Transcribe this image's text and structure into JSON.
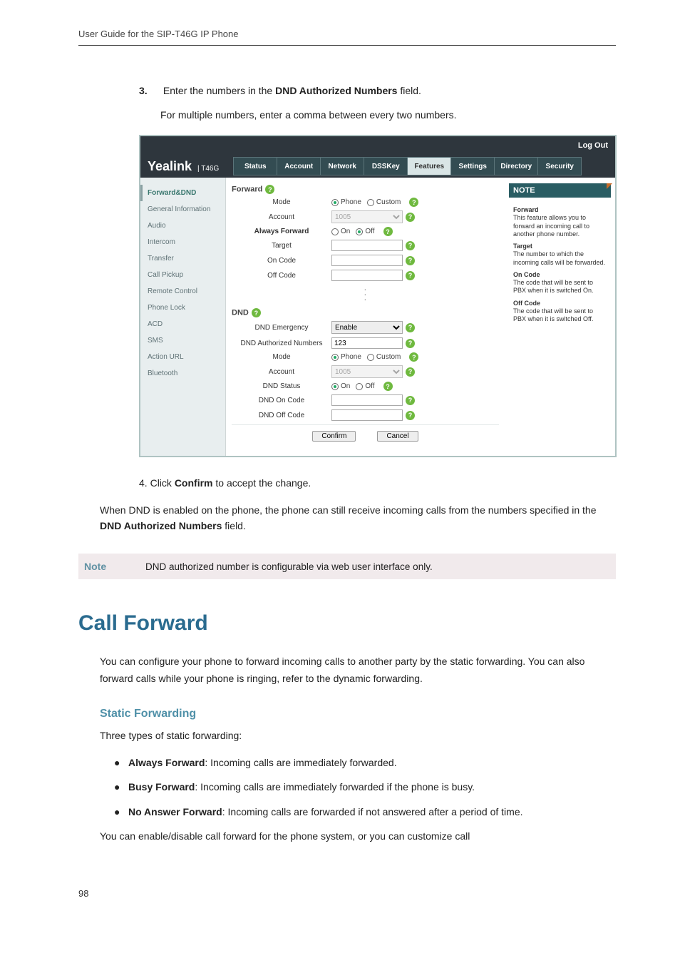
{
  "running_head": "User Guide for the SIP-T46G IP Phone",
  "step3": {
    "num": "3.",
    "pre": "Enter the numbers in the ",
    "bold": "DND Authorized Numbers",
    "post": " field."
  },
  "step3_sub": "For multiple numbers, enter a comma between every two numbers.",
  "shot": {
    "logout": "Log Out",
    "brand": "Yealink",
    "brand_sub": "T46G",
    "tabs": [
      "Status",
      "Account",
      "Network",
      "DSSKey",
      "Features",
      "Settings",
      "Directory",
      "Security"
    ],
    "active_tab_index": 4,
    "sidebar": [
      "Forward&DND",
      "General Information",
      "Audio",
      "Intercom",
      "Transfer",
      "Call Pickup",
      "Remote Control",
      "Phone Lock",
      "ACD",
      "SMS",
      "Action URL",
      "Bluetooth"
    ],
    "active_sidebar_index": 0,
    "sec_forward": "Forward",
    "sec_dnd": "DND",
    "rows_forward": {
      "mode": "Mode",
      "mode_phone": "Phone",
      "mode_custom": "Custom",
      "account": "Account",
      "account_val": "1005",
      "always": "Always Forward",
      "on": "On",
      "off": "Off",
      "target": "Target",
      "oncode": "On Code",
      "offcode": "Off Code"
    },
    "rows_dnd": {
      "emerg": "DND Emergency",
      "emerg_val": "Enable",
      "auth": "DND Authorized Numbers",
      "auth_val": "123",
      "mode": "Mode",
      "mode_phone": "Phone",
      "mode_custom": "Custom",
      "account": "Account",
      "account_val": "1005",
      "status": "DND Status",
      "on": "On",
      "off": "Off",
      "doncode": "DND On Code",
      "doffcode": "DND Off Code"
    },
    "note": {
      "hd": "NOTE",
      "b1t": "Forward",
      "b1": "This feature allows you to forward an incoming call to another phone number.",
      "b2t": "Target",
      "b2": "The number to which the incoming calls will be forwarded.",
      "b3t": "On Code",
      "b3": "The code that will be sent to PBX when it is switched On.",
      "b4t": "Off Code",
      "b4": "The code that will be sent to PBX when it is switched Off."
    },
    "confirm": "Confirm",
    "cancel": "Cancel"
  },
  "step4": {
    "num": "4.",
    "pre": "Click ",
    "bold": "Confirm",
    "post": " to accept the change."
  },
  "dnd_para_a": "When DND is enabled on the phone, the phone can still receive incoming calls from the numbers specified in the ",
  "dnd_para_bold": "DND Authorized Numbers",
  "dnd_para_b": " field.",
  "note_label": "Note",
  "note_text": "DND authorized number is configurable via web user interface only.",
  "h1": "Call Forward",
  "cf_para": "You can configure your phone to forward incoming calls to another party by the static forwarding. You can also forward calls while your phone is ringing, refer to the dynamic forwarding.",
  "sf_hd": "Static Forwarding",
  "sf_intro": "Three types of static forwarding:",
  "bul": [
    {
      "b": "Always Forward",
      "t": ": Incoming calls are immediately forwarded."
    },
    {
      "b": "Busy Forward",
      "t": ": Incoming calls are immediately forwarded if the phone is busy."
    },
    {
      "b": "No Answer Forward",
      "t": ": Incoming calls are forwarded if not answered after a period of time."
    }
  ],
  "closing": "You can enable/disable call forward for the phone system, or you can customize call",
  "page_num": "98"
}
